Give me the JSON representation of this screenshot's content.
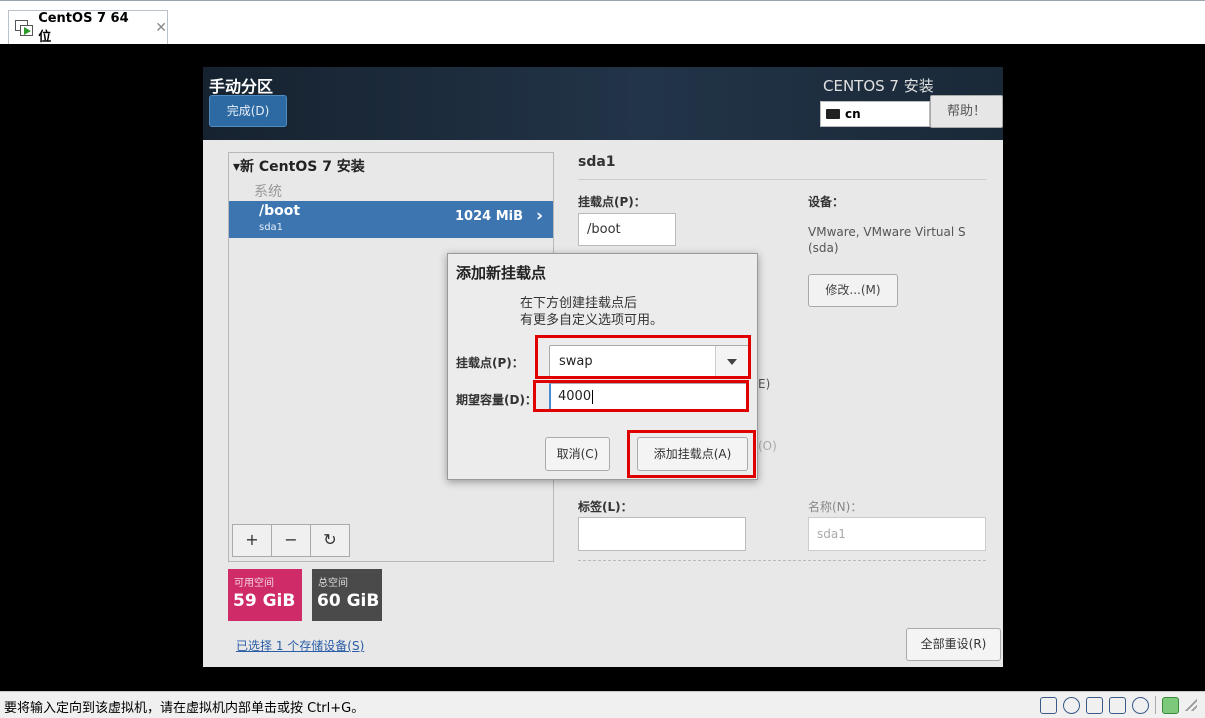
{
  "vmware": {
    "tab_title": "CentOS 7 64 位",
    "tab_close": "✕",
    "status_message": "要将输入定向到该虚拟机，请在虚拟机内部单击或按 Ctrl+G。"
  },
  "installer": {
    "page_title": "手动分区",
    "done_button": "完成(D)",
    "product_title": "CENTOS 7 安装",
    "keyboard_layout": "cn",
    "help_button": "帮助！",
    "left": {
      "tree_header": "▾新 CentOS 7 安装",
      "section": "系统",
      "selected_mount": "/boot",
      "selected_device": "sda1",
      "selected_size": "1024 MiB",
      "chevron": "›",
      "toolbar": {
        "add": "+",
        "remove": "−",
        "refresh": "↻"
      },
      "free_space_label": "可用空间",
      "free_space_value": "59 GiB",
      "total_space_label": "总空间",
      "total_space_value": "60 GiB",
      "storage_link": "已选择 1 个存储设备(S)"
    },
    "right": {
      "partition_title": "sda1",
      "mount_point_label": "挂载点(P)：",
      "mount_point_value": "/boot",
      "device_label": "设备：",
      "device_value": "VMware, VMware Virtual S (sda)",
      "modify_button": "修改...(M)",
      "partial_text_1": "E)",
      "partial_text_2": "(O)",
      "label_label": "标签(L)：",
      "label_value": "",
      "name_label": "名称(N)：",
      "name_value": "sda1",
      "reset_button": "全部重设(R)"
    }
  },
  "dialog": {
    "title": "添加新挂载点",
    "description_line1": "在下方创建挂载点后",
    "description_line2": "有更多自定义选项可用。",
    "mount_point_label": "挂载点(P)：",
    "mount_point_value": "swap",
    "capacity_label": "期望容量(D)：",
    "capacity_value": "4000",
    "cancel_button": "取消(C)",
    "add_button": "添加挂载点(A)"
  },
  "colors": {
    "selection": "#3d75b0",
    "free_space": "#cf2b69",
    "highlight": "#e00000"
  }
}
